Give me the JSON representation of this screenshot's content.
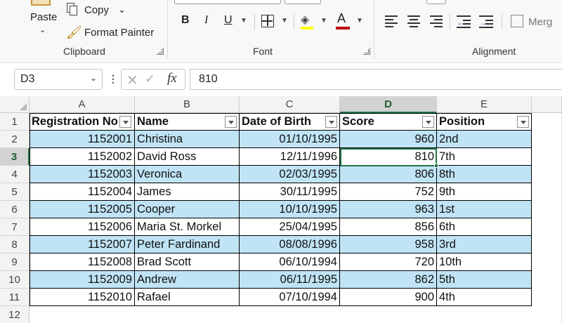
{
  "ribbon": {
    "clipboard": {
      "paste_label": "Paste",
      "copy_label": "Copy",
      "format_painter_label": "Format Painter",
      "group_label": "Clipboard"
    },
    "font": {
      "bold": "B",
      "italic": "I",
      "underline": "U",
      "font_color_glyph": "A",
      "group_label": "Font"
    },
    "alignment": {
      "merge_label": "Merg",
      "group_label": "Alignment"
    }
  },
  "formula_bar": {
    "name_box": "D3",
    "fx": "fx",
    "value": "810"
  },
  "grid": {
    "columns": [
      "A",
      "B",
      "C",
      "D",
      "E"
    ],
    "selected_column": "D",
    "row_numbers": [
      "1",
      "2",
      "3",
      "4",
      "5",
      "6",
      "7",
      "8",
      "9",
      "10",
      "11",
      "12"
    ],
    "selected_row": "3",
    "headers": [
      "Registration No",
      "Name",
      "Date of Birth",
      "Score",
      "Position"
    ],
    "rows": [
      [
        "1152001",
        "Christina",
        "01/10/1995",
        "960",
        "2nd"
      ],
      [
        "1152002",
        "David Ross",
        "12/11/1996",
        "810",
        "7th"
      ],
      [
        "1152003",
        "Veronica",
        "02/03/1995",
        "806",
        "8th"
      ],
      [
        "1152004",
        "James",
        "30/11/1995",
        "752",
        "9th"
      ],
      [
        "1152005",
        "Cooper",
        "10/10/1995",
        "963",
        "1st"
      ],
      [
        "1152006",
        "Maria St. Morkel",
        "25/04/1995",
        "856",
        "6th"
      ],
      [
        "1152007",
        "Peter Fardinand",
        "08/08/1996",
        "958",
        "3rd"
      ],
      [
        "1152008",
        "Brad Scott",
        "06/10/1994",
        "720",
        "10th"
      ],
      [
        "1152009",
        "Andrew",
        "06/11/1995",
        "862",
        "5th"
      ],
      [
        "1152010",
        "Rafael",
        "07/10/1994",
        "900",
        "4th"
      ]
    ],
    "banded_fill": "#c0e4f5",
    "selection_color": "#217346"
  }
}
